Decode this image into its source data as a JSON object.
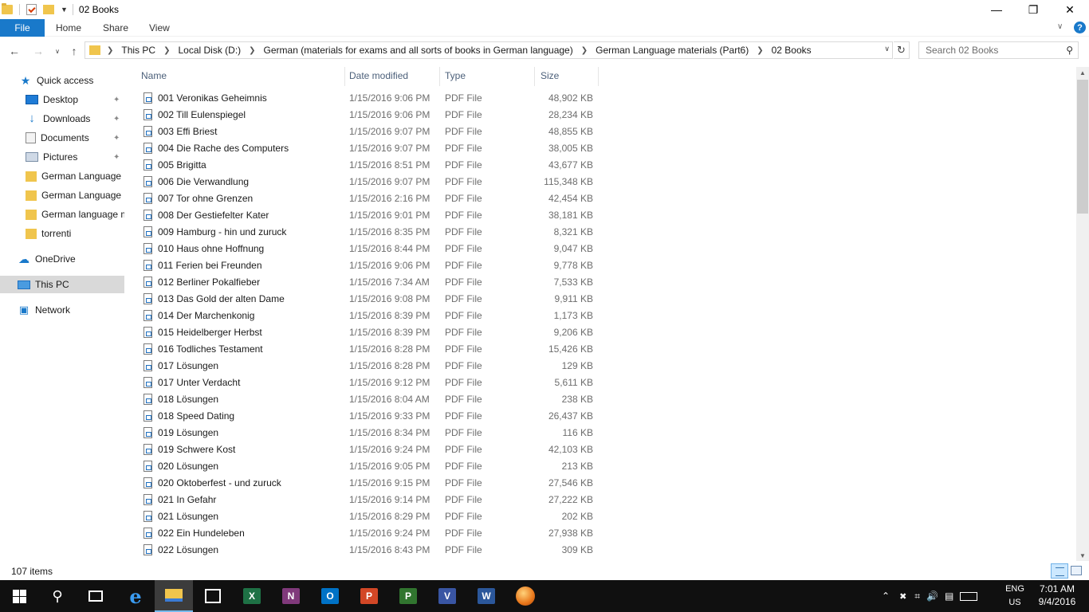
{
  "window": {
    "title": "02 Books"
  },
  "ribbon": {
    "file": "File",
    "home": "Home",
    "share": "Share",
    "view": "View"
  },
  "address": {
    "crumbs": [
      "This PC",
      "Local Disk (D:)",
      "German (materials for exams and all sorts of books in German language)",
      "German Language materials (Part6)",
      "02 Books"
    ]
  },
  "search": {
    "placeholder": "Search 02 Books"
  },
  "nav": {
    "quick_access": "Quick access",
    "desktop": "Desktop",
    "downloads": "Downloads",
    "documents": "Documents",
    "pictures": "Pictures",
    "folder1": "German Language m",
    "folder2": "German Language m",
    "folder3": "German language m",
    "folder4": "torrenti",
    "onedrive": "OneDrive",
    "thispc": "This PC",
    "network": "Network"
  },
  "columns": {
    "name": "Name",
    "date": "Date modified",
    "type": "Type",
    "size": "Size"
  },
  "files": [
    {
      "name": "001 Veronikas Geheimnis",
      "date": "1/15/2016 9:06 PM",
      "type": "PDF File",
      "size": "48,902 KB"
    },
    {
      "name": "002 Till Eulenspiegel",
      "date": "1/15/2016 9:06 PM",
      "type": "PDF File",
      "size": "28,234 KB"
    },
    {
      "name": "003 Effi Briest",
      "date": "1/15/2016 9:07 PM",
      "type": "PDF File",
      "size": "48,855 KB"
    },
    {
      "name": "004 Die Rache des Computers",
      "date": "1/15/2016 9:07 PM",
      "type": "PDF File",
      "size": "38,005 KB"
    },
    {
      "name": "005 Brigitta",
      "date": "1/15/2016 8:51 PM",
      "type": "PDF File",
      "size": "43,677 KB"
    },
    {
      "name": "006 Die Verwandlung",
      "date": "1/15/2016 9:07 PM",
      "type": "PDF File",
      "size": "115,348 KB"
    },
    {
      "name": "007 Tor ohne Grenzen",
      "date": "1/15/2016 2:16 PM",
      "type": "PDF File",
      "size": "42,454 KB"
    },
    {
      "name": "008 Der Gestiefelter Kater",
      "date": "1/15/2016 9:01 PM",
      "type": "PDF File",
      "size": "38,181 KB"
    },
    {
      "name": "009 Hamburg - hin und zuruck",
      "date": "1/15/2016 8:35 PM",
      "type": "PDF File",
      "size": "8,321 KB"
    },
    {
      "name": "010 Haus ohne Hoffnung",
      "date": "1/15/2016 8:44 PM",
      "type": "PDF File",
      "size": "9,047 KB"
    },
    {
      "name": "011 Ferien bei Freunden",
      "date": "1/15/2016 9:06 PM",
      "type": "PDF File",
      "size": "9,778 KB"
    },
    {
      "name": "012 Berliner Pokalfieber",
      "date": "1/15/2016 7:34 AM",
      "type": "PDF File",
      "size": "7,533 KB"
    },
    {
      "name": "013 Das Gold der alten Dame",
      "date": "1/15/2016 9:08 PM",
      "type": "PDF File",
      "size": "9,911 KB"
    },
    {
      "name": "014 Der Marchenkonig",
      "date": "1/15/2016 8:39 PM",
      "type": "PDF File",
      "size": "1,173 KB"
    },
    {
      "name": "015 Heidelberger Herbst",
      "date": "1/15/2016 8:39 PM",
      "type": "PDF File",
      "size": "9,206 KB"
    },
    {
      "name": "016 Todliches Testament",
      "date": "1/15/2016 8:28 PM",
      "type": "PDF File",
      "size": "15,426 KB"
    },
    {
      "name": "017 Lösungen",
      "date": "1/15/2016 8:28 PM",
      "type": "PDF File",
      "size": "129 KB"
    },
    {
      "name": "017 Unter Verdacht",
      "date": "1/15/2016 9:12 PM",
      "type": "PDF File",
      "size": "5,611 KB"
    },
    {
      "name": "018 Lösungen",
      "date": "1/15/2016 8:04 AM",
      "type": "PDF File",
      "size": "238 KB"
    },
    {
      "name": "018 Speed Dating",
      "date": "1/15/2016 9:33 PM",
      "type": "PDF File",
      "size": "26,437 KB"
    },
    {
      "name": "019 Lösungen",
      "date": "1/15/2016 8:34 PM",
      "type": "PDF File",
      "size": "116 KB"
    },
    {
      "name": "019 Schwere Kost",
      "date": "1/15/2016 9:24 PM",
      "type": "PDF File",
      "size": "42,103 KB"
    },
    {
      "name": "020 Lösungen",
      "date": "1/15/2016 9:05 PM",
      "type": "PDF File",
      "size": "213 KB"
    },
    {
      "name": "020 Oktoberfest - und zuruck",
      "date": "1/15/2016 9:15 PM",
      "type": "PDF File",
      "size": "27,546 KB"
    },
    {
      "name": "021 In Gefahr",
      "date": "1/15/2016 9:14 PM",
      "type": "PDF File",
      "size": "27,222 KB"
    },
    {
      "name": "021 Lösungen",
      "date": "1/15/2016 8:29 PM",
      "type": "PDF File",
      "size": "202 KB"
    },
    {
      "name": "022 Ein Hundeleben",
      "date": "1/15/2016 9:24 PM",
      "type": "PDF File",
      "size": "27,938 KB"
    },
    {
      "name": "022 Lösungen",
      "date": "1/15/2016 8:43 PM",
      "type": "PDF File",
      "size": "309 KB"
    }
  ],
  "status": {
    "count": "107 items"
  },
  "taskbar": {
    "apps": [
      "start",
      "search",
      "task-view",
      "edge",
      "file-explorer",
      "store",
      "excel",
      "onenote",
      "outlook",
      "powerpoint",
      "project",
      "visio",
      "word",
      "media"
    ],
    "lang_line1": "ENG",
    "lang_line2": "US",
    "time": "7:01 AM",
    "date": "9/4/2016"
  },
  "colors": {
    "accent": "#1979ca",
    "taskbar": "#101010",
    "header_text": "#4c607a"
  }
}
